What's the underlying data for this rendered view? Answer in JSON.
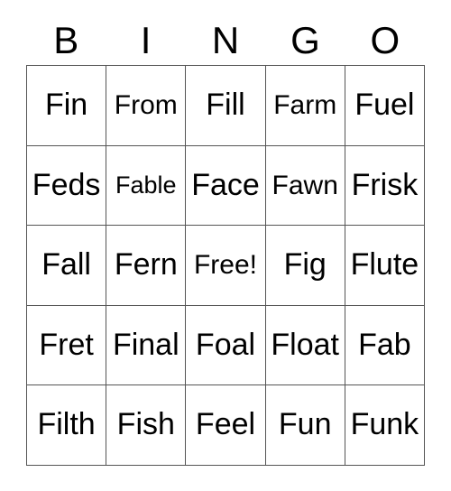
{
  "card": {
    "title": "BINGO",
    "free_space_label": "Free!",
    "colors": {
      "background": "#ffffff",
      "text": "#000000",
      "grid_line": "#555555"
    },
    "headers": [
      "B",
      "I",
      "N",
      "G",
      "O"
    ],
    "rows": [
      [
        {
          "label": "Fin",
          "size": "lg"
        },
        {
          "label": "From",
          "size": "md"
        },
        {
          "label": "Fill",
          "size": "lg"
        },
        {
          "label": "Farm",
          "size": "md"
        },
        {
          "label": "Fuel",
          "size": "lg"
        }
      ],
      [
        {
          "label": "Feds",
          "size": "lg"
        },
        {
          "label": "Fable",
          "size": "sm"
        },
        {
          "label": "Face",
          "size": "lg"
        },
        {
          "label": "Fawn",
          "size": "md"
        },
        {
          "label": "Frisk",
          "size": "lg"
        }
      ],
      [
        {
          "label": "Fall",
          "size": "lg"
        },
        {
          "label": "Fern",
          "size": "lg"
        },
        {
          "label": "Free!",
          "size": "md"
        },
        {
          "label": "Fig",
          "size": "lg"
        },
        {
          "label": "Flute",
          "size": "lg"
        }
      ],
      [
        {
          "label": "Fret",
          "size": "lg"
        },
        {
          "label": "Final",
          "size": "lg"
        },
        {
          "label": "Foal",
          "size": "lg"
        },
        {
          "label": "Float",
          "size": "lg"
        },
        {
          "label": "Fab",
          "size": "lg"
        }
      ],
      [
        {
          "label": "Filth",
          "size": "lg"
        },
        {
          "label": "Fish",
          "size": "lg"
        },
        {
          "label": "Feel",
          "size": "lg"
        },
        {
          "label": "Fun",
          "size": "lg"
        },
        {
          "label": "Funk",
          "size": "lg"
        }
      ]
    ]
  }
}
